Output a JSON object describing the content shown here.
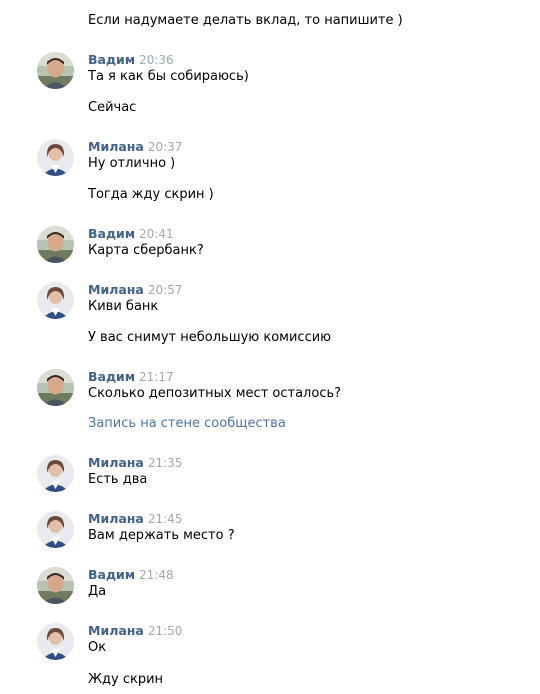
{
  "chat": {
    "intro_message": "Если надумаете делать вклад, то напишите )",
    "groups": [
      {
        "author": "Вадим",
        "time": "20:36",
        "messages": [
          "Та я как бы собираюсь)",
          "Сейчас"
        ]
      },
      {
        "author": "Милана",
        "time": "20:37",
        "messages": [
          "Ну отлично )",
          "Тогда жду скрин )"
        ]
      },
      {
        "author": "Вадим",
        "time": "20:41",
        "messages": [
          "Карта сбербанк?"
        ]
      },
      {
        "author": "Милана",
        "time": "20:57",
        "messages": [
          "Киви банк",
          "У вас снимут небольшую комиссию"
        ]
      },
      {
        "author": "Вадим",
        "time": "21:17",
        "messages": [
          "Сколько депозитных мест осталось?"
        ],
        "attachment": "Запись на стене сообщества"
      },
      {
        "author": "Милана",
        "time": "21:35",
        "messages": [
          "Есть два"
        ]
      },
      {
        "author": "Милана",
        "time": "21:45",
        "messages": [
          "Вам держать место ?"
        ]
      },
      {
        "author": "Вадим",
        "time": "21:48",
        "messages": [
          "Да"
        ]
      },
      {
        "author": "Милана",
        "time": "21:50",
        "messages": [
          "Ок",
          "Жду скрин"
        ]
      }
    ]
  },
  "colors": {
    "author_name": "#42648b",
    "timestamp": "#a0a9b3",
    "link": "#4a76a8",
    "text": "#000000"
  }
}
